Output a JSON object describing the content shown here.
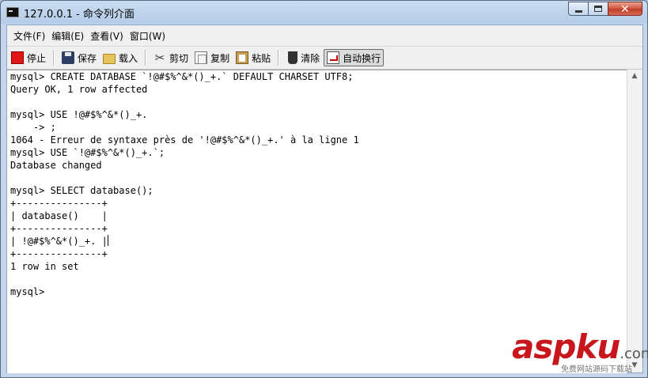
{
  "window": {
    "title": "127.0.0.1 - 命令列介面",
    "minimize": "minimize",
    "maximize": "maximize",
    "close": "close"
  },
  "menu": [
    {
      "label": "文件(F)"
    },
    {
      "label": "编辑(E)"
    },
    {
      "label": "查看(V)"
    },
    {
      "label": "窗口(W)"
    }
  ],
  "toolbar": {
    "stop": "停止",
    "save": "保存",
    "load": "载入",
    "cut": "剪切",
    "copy": "复制",
    "paste": "粘贴",
    "clear": "清除",
    "wrap": "自动换行"
  },
  "icons": {
    "stop": "stop-icon",
    "save": "save-icon",
    "load": "folder-icon",
    "cut": "scissors-icon",
    "copy": "copy-icon",
    "paste": "paste-icon",
    "clear": "trash-icon",
    "wrap": "word-wrap-icon"
  },
  "console": {
    "lines": [
      "mysql> CREATE DATABASE `!@#$%^&*()_+.` DEFAULT CHARSET UTF8;",
      "Query OK, 1 row affected",
      "",
      "mysql> USE !@#$%^&*()_+.",
      "    -> ;",
      "1064 - Erreur de syntaxe près de '!@#$%^&*()_+.' à la ligne 1",
      "mysql> USE `!@#$%^&*()_+.`;",
      "Database changed",
      "",
      "mysql> SELECT database();",
      "+---------------+",
      "| database()    |",
      "+---------------+",
      "| !@#$%^&*()_+. |",
      "+---------------+",
      "1 row in set",
      "",
      "mysql>"
    ]
  },
  "watermark": {
    "brand": "aspku",
    "suffix": ".com",
    "subtitle": "免费网站源码下载站"
  },
  "colors": {
    "accent_red": "#c8161d",
    "console_bg": "#ffffff",
    "chrome": "#f0f0f0"
  }
}
